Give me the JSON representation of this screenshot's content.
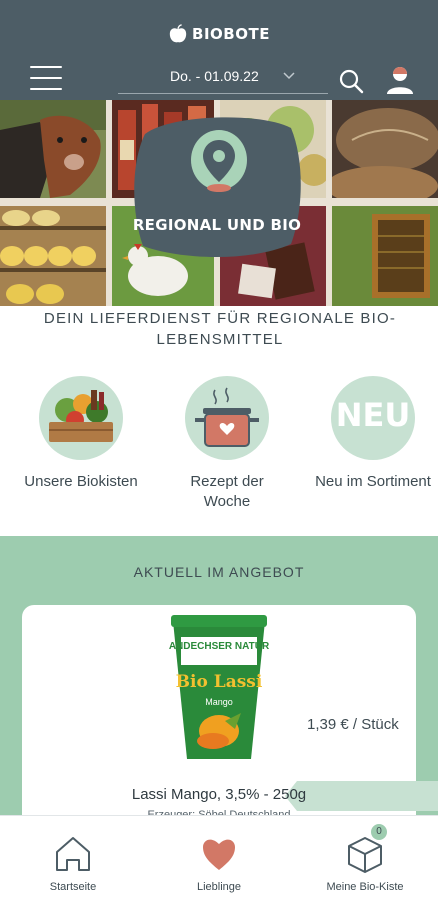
{
  "header": {
    "brand": "BIOBOTE",
    "date_value": "Do. - 01.09.22"
  },
  "hero": {
    "badge_text": "REGIONAL UND BIO",
    "tagline": "DEIN LIEFERDIENST FÜR REGIONALE BIO-LEBENSMITTEL"
  },
  "quick_links": [
    {
      "label": "Unsere Biokisten",
      "icon": "veggie-crate-icon"
    },
    {
      "label": "Rezept der Woche",
      "icon": "cooking-pot-icon"
    },
    {
      "label": "Neu im Sortiment",
      "icon": "new-badge-icon",
      "badge": "NEU"
    }
  ],
  "offers": {
    "title": "AKTUELL IM ANGEBOT",
    "product": {
      "name": "Lassi Mango, 3,5% - 250g",
      "sub": "Erzeuger: Söbel Deutschland",
      "price": "1,39 € / Stück",
      "cup_brand": "ANDECHSER NATUR",
      "cup_title": "Bio Lassi",
      "cup_flavor": "Mango"
    }
  },
  "bottom_nav": [
    {
      "label": "Startseite",
      "icon": "home-icon"
    },
    {
      "label": "Lieblinge",
      "icon": "heart-icon"
    },
    {
      "label": "Meine Bio-Kiste",
      "icon": "box-icon",
      "count": "0"
    }
  ],
  "colors": {
    "header_bg": "#4d5d66",
    "accent_green": "#9dccaf",
    "light_green": "#c7e1d2",
    "heart": "#d27866"
  }
}
